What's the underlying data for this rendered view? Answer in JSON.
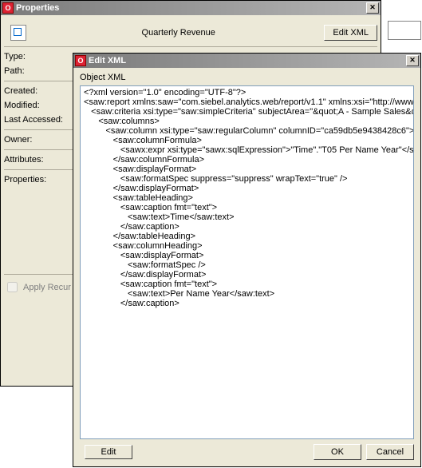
{
  "propsWindow": {
    "title": "Properties",
    "objectTitle": "Quarterly Revenue",
    "editXmlBtn": "Edit XML",
    "labels": {
      "type": "Type:",
      "path": "Path:",
      "created": "Created:",
      "modified": "Modified:",
      "lastAccessed": "Last Accessed:",
      "owner": "Owner:",
      "attributes": "Attributes:",
      "properties": "Properties:"
    },
    "applyRecursively": "Apply Recur"
  },
  "xmlWindow": {
    "title": "Edit XML",
    "label": "Object XML",
    "editBtn": "Edit",
    "okBtn": "OK",
    "cancelBtn": "Cancel",
    "content": "<?xml version=\"1.0\" encoding=\"UTF-8\"?>\n<saw:report xmlns:saw=\"com.siebel.analytics.web/report/v1.1\" xmlns:xsi=\"http://www.w3.org/2001/XMLSchema-instance\" xmlns:xsd=\"http://www.w3.org/2001/XMLSchema\" xmlns:sawx=\"com.siebel.analytics.web/expression/v1.1\" xmlVersion=\"200810080\">\n   <saw:criteria xsi:type=\"saw:simpleCriteria\" subjectArea=\"&quot;A - Sample Sales&quot;\" withinHierarchy=\"true\">\n      <saw:columns>\n         <saw:column xsi:type=\"saw:regularColumn\" columnID=\"ca59db5e9438428c6\">\n            <saw:columnFormula>\n               <sawx:expr xsi:type=\"sawx:sqlExpression\">\"Time\".\"T05 Per Name Year\"</sawx:expr>\n            </saw:columnFormula>\n            <saw:displayFormat>\n               <saw:formatSpec suppress=\"suppress\" wrapText=\"true\" />\n            </saw:displayFormat>\n            <saw:tableHeading>\n               <saw:caption fmt=\"text\">\n                  <saw:text>Time</saw:text>\n               </saw:caption>\n            </saw:tableHeading>\n            <saw:columnHeading>\n               <saw:displayFormat>\n                  <saw:formatSpec />\n               </saw:displayFormat>\n               <saw:caption fmt=\"text\">\n                  <saw:text>Per Name Year</saw:text>\n               </saw:caption>"
  }
}
